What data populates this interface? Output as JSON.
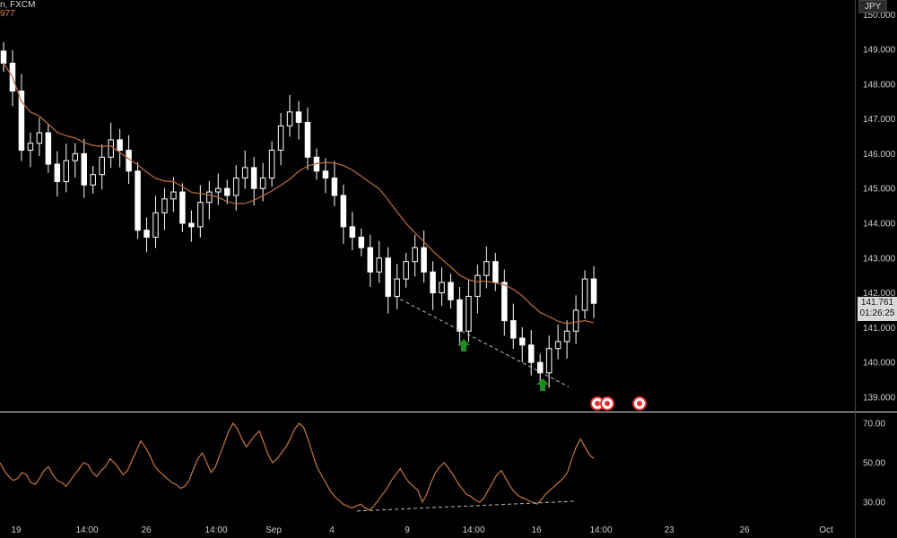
{
  "header": {
    "symbol_text": "n, FXCM",
    "ma_value_text": "977",
    "currency_badge": "JPY",
    "top_partial": "150.000"
  },
  "colors": {
    "background": "#000000",
    "candle": "#ffffff",
    "moving_average": "#b5673a",
    "oscillator": "#c8763e",
    "trend_dashed": "#bbbbbb",
    "arrow": "#1e8c1e",
    "axis_text": "#cfcfcf",
    "separator": "#e0e0e0"
  },
  "price_axis": {
    "ticks": [
      "149.000",
      "148.000",
      "147.000",
      "146.000",
      "145.000",
      "144.000",
      "143.000",
      "142.000",
      "141.000",
      "140.000",
      "139.000"
    ],
    "current_price": "141.761",
    "countdown": "01:26:25"
  },
  "oscillator_axis": {
    "ticks": [
      "70.00",
      "50.00",
      "30.00"
    ]
  },
  "time_axis": {
    "ticks": [
      "19",
      "14:00",
      "26",
      "14:00",
      "Sep",
      "4",
      "9",
      "14:00",
      "16",
      "14:00",
      "23",
      "26",
      "Oct"
    ]
  },
  "chart_data": [
    {
      "type": "candlestick",
      "series_unit": "JPY",
      "ylim": [
        138.6,
        150.5
      ],
      "close": [
        148.6,
        147.8,
        146.1,
        146.3,
        146.6,
        145.7,
        145.2,
        145.8,
        146.0,
        145.1,
        145.4,
        145.9,
        146.4,
        146.1,
        145.5,
        143.8,
        143.6,
        144.3,
        144.7,
        144.9,
        144.0,
        143.9,
        144.6,
        144.9,
        145.0,
        144.8,
        145.3,
        145.6,
        145.0,
        145.3,
        146.1,
        146.8,
        147.2,
        146.9,
        145.9,
        145.5,
        145.3,
        144.8,
        143.9,
        143.6,
        143.3,
        142.6,
        143.0,
        141.9,
        142.4,
        142.9,
        143.3,
        142.6,
        142.0,
        142.3,
        141.8,
        140.9,
        141.9,
        142.5,
        142.9,
        142.3,
        141.2,
        140.7,
        140.5,
        140.0,
        139.7,
        140.4,
        140.6,
        140.9,
        141.5,
        142.4,
        141.7
      ],
      "ma_value_range": [
        139.0,
        150.0
      ],
      "trendline": {
        "from_price": 141.9,
        "to_price": 139.3
      },
      "markers": [
        "arrow-up",
        "arrow-up"
      ]
    },
    {
      "type": "line",
      "ylim": [
        22,
        78
      ],
      "values": [
        50,
        46,
        43,
        41,
        42,
        45,
        44,
        40,
        39,
        42,
        46,
        48,
        44,
        41,
        40,
        38,
        41,
        44,
        47,
        50,
        49,
        45,
        43,
        46,
        48,
        52,
        50,
        47,
        44,
        46,
        51,
        56,
        61,
        58,
        54,
        49,
        46,
        44,
        42,
        40,
        39,
        37,
        38,
        41,
        47,
        52,
        55,
        50,
        45,
        48,
        54,
        60,
        66,
        70,
        67,
        62,
        58,
        61,
        64,
        66,
        60,
        54,
        50,
        52,
        55,
        58,
        62,
        67,
        70,
        68,
        62,
        55,
        48,
        44,
        40,
        36,
        33,
        31,
        29,
        28,
        27,
        28,
        29,
        27,
        26,
        28,
        31,
        34,
        37,
        41,
        44,
        47,
        43,
        40,
        38,
        36,
        30,
        34,
        40,
        45,
        48,
        50,
        47,
        44,
        40,
        37,
        34,
        33,
        31,
        30,
        32,
        36,
        40,
        44,
        46,
        42,
        38,
        35,
        33,
        32,
        31,
        30,
        29,
        31,
        34,
        36,
        38,
        40,
        42,
        45,
        52,
        58,
        62,
        58,
        54,
        52
      ]
    }
  ]
}
